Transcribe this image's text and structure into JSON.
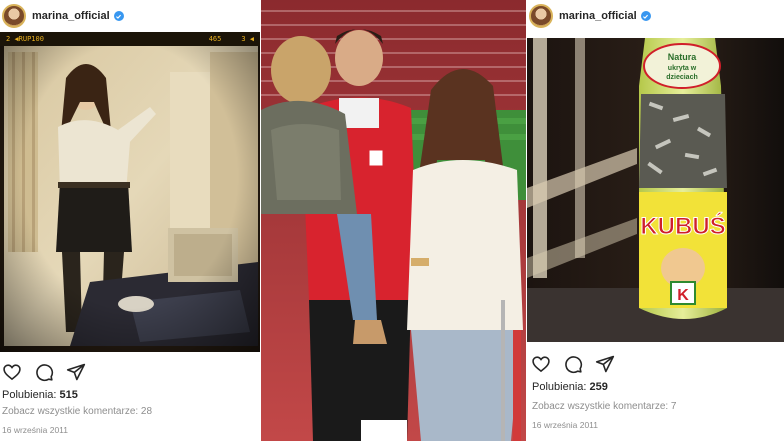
{
  "left_post": {
    "username": "marina_official",
    "camera_bar": {
      "left": "2 ◀",
      "model": "RUP100",
      "counter": "465",
      "right": "3 ◀"
    },
    "likes_label": "Polubienia:",
    "likes_count": "515",
    "comments_link": "Zobacz wszystkie komentarze: 28",
    "date": "16 września 2011"
  },
  "right_post": {
    "username": "marina_official",
    "bottle_text": {
      "top": "Natura",
      "middle": "ukryta w",
      "bottom": "dzieciach",
      "brand": "KUBUŚ",
      "letter": "K"
    },
    "likes_label": "Polubienia:",
    "likes_count": "259",
    "comments_link": "Zobacz wszystkie komentarze: 7",
    "date": "16 września 2011"
  },
  "icons": {
    "like": "heart-icon",
    "comment": "comment-icon",
    "share": "send-icon",
    "verified": "verified-badge-icon"
  },
  "colors": {
    "verified_blue": "#3897f0",
    "text_primary": "#262626",
    "text_secondary": "#8e8e8e",
    "camera_bar_text": "#e8b020"
  }
}
